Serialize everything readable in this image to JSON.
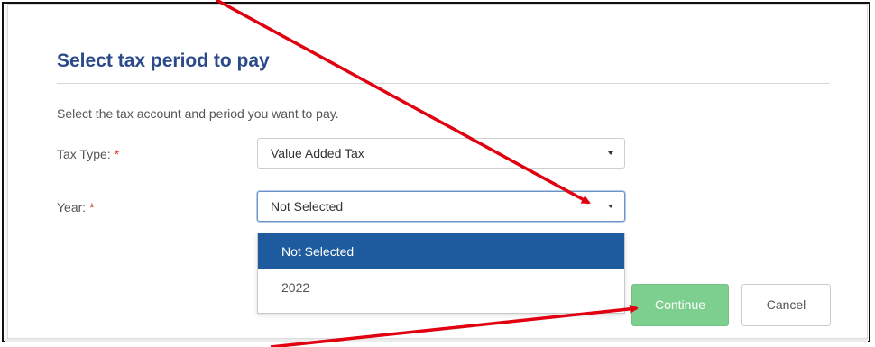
{
  "form": {
    "title": "Select tax period to pay",
    "intro": "Select the tax account and period you want to pay.",
    "required_marker": "*",
    "tax_type": {
      "label": "Tax Type:",
      "value": "Value Added Tax"
    },
    "year": {
      "label": "Year:",
      "value": "Not Selected",
      "options": [
        "Not Selected",
        "2022"
      ],
      "highlighted_option": "Not Selected"
    }
  },
  "actions": {
    "continue_label": "Continue",
    "cancel_label": "Cancel"
  },
  "colors": {
    "title": "#2b4a8a",
    "required": "#d9342b",
    "highlight": "#1d5a9e",
    "continue": "#7ccf8e",
    "annotation_arrow": "#e0000f"
  },
  "icons": {
    "dropdown_caret": "chevron-down-icon",
    "annotation": "red-arrow"
  }
}
